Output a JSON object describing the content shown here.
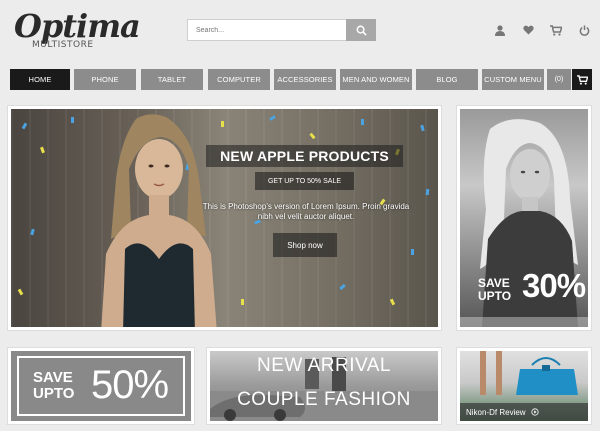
{
  "logo": {
    "main": "Optima",
    "sub": "MULTISTORE"
  },
  "search": {
    "placeholder": "Search..."
  },
  "top_icons": [
    "user-icon",
    "heart-icon",
    "cart-icon",
    "power-icon"
  ],
  "nav": {
    "items": [
      {
        "label": "Home",
        "active": true
      },
      {
        "label": "Phone"
      },
      {
        "label": "Tablet"
      },
      {
        "label": "Computer"
      },
      {
        "label": "Accessories"
      },
      {
        "label": "Men and Women"
      },
      {
        "label": "Blog"
      },
      {
        "label": "Custom Menu"
      }
    ],
    "cart_count": "(0)"
  },
  "hero": {
    "title": "NEW APPLE PRODUCTS",
    "sale": "GET UP TO 50% SALE",
    "desc": "This is Photoshop's version of Lorem Ipsum. Proin gravida nibh vel velit auctor aliquet.",
    "cta": "Shop now"
  },
  "side_promo": {
    "save": "SAVE",
    "upto": "UPTO",
    "percent": "30%"
  },
  "banner_left": {
    "save": "SAVE",
    "upto": "UPTO",
    "percent": "50%"
  },
  "banner_mid": {
    "line1": "NEW ARRIVAL",
    "line2": "COUPLE FASHION"
  },
  "banner_right": {
    "caption": "Nikon-Df Review"
  },
  "colors": {
    "nav_bg": "#8c8c8c",
    "nav_active": "#1a1a1a",
    "page_bg": "#ececec"
  }
}
